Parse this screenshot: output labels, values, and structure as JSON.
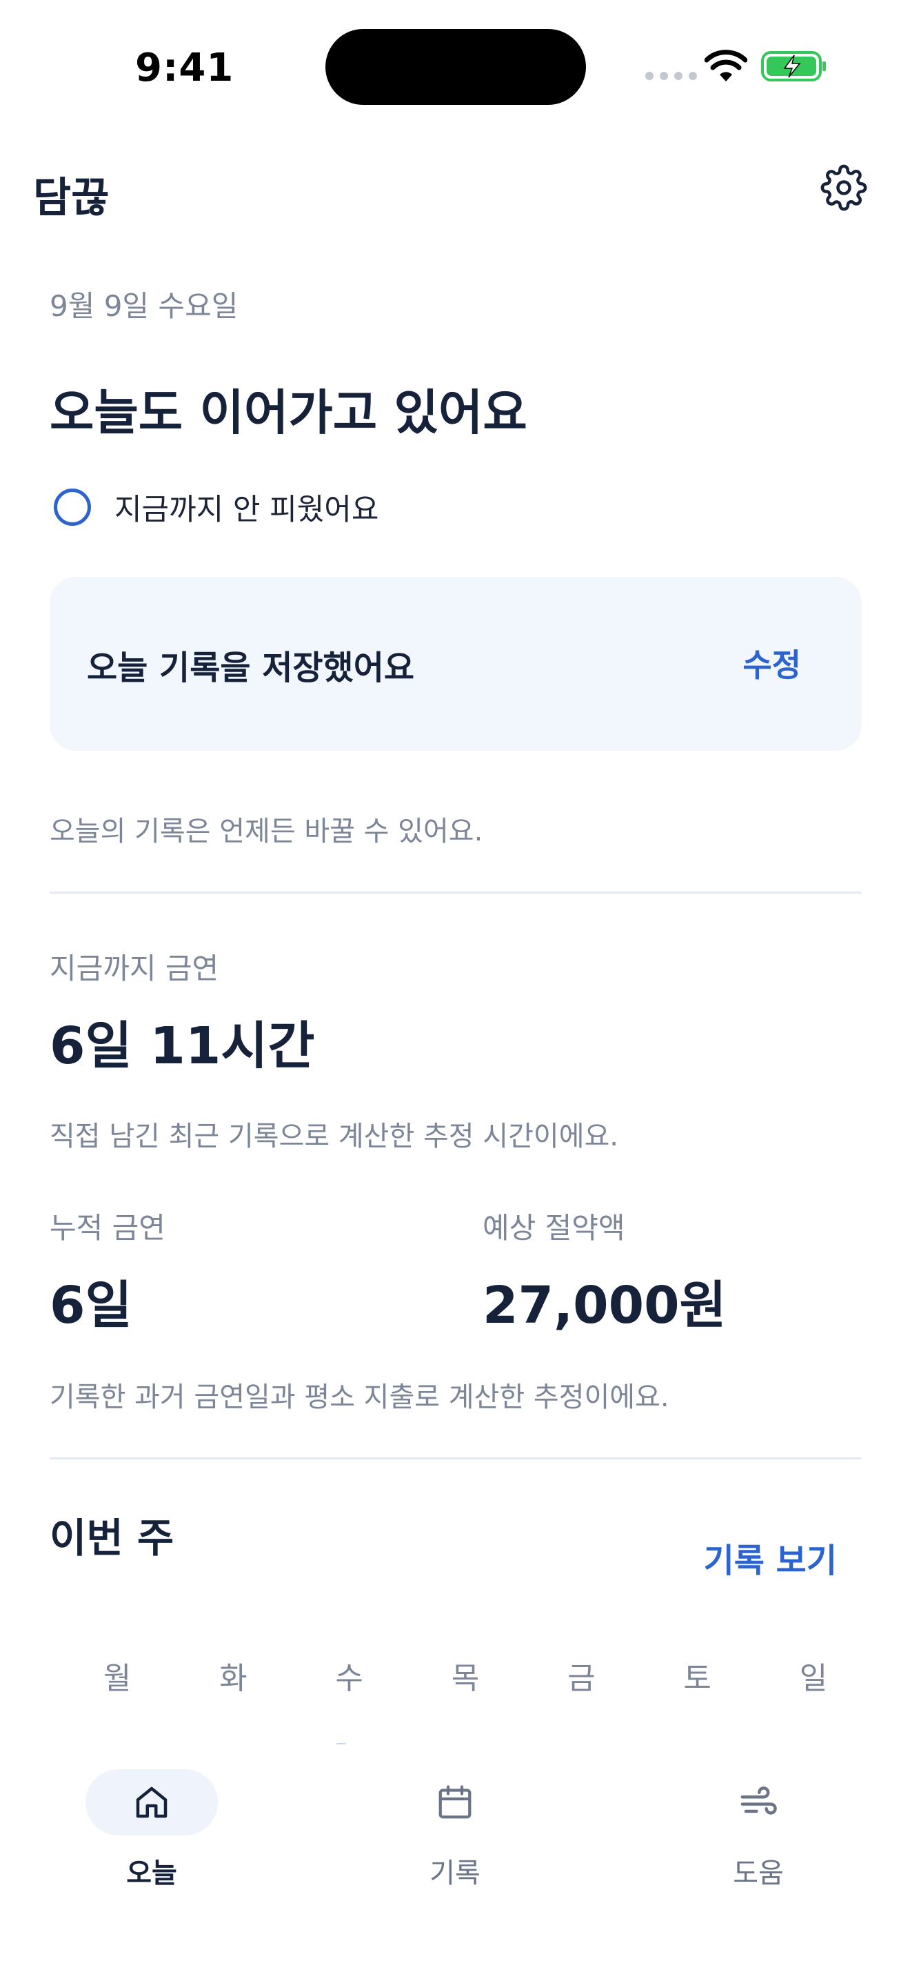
{
  "status_bar": {
    "time": "9:41"
  },
  "header": {
    "app_title": "담끊"
  },
  "today": {
    "date": "9월 9일 수요일",
    "headline": "오늘도 이어가고 있어요",
    "check_label": "지금까지 안 피웠어요",
    "saved_text": "오늘 기록을 저장했어요",
    "edit_label": "수정",
    "note": "오늘의 기록은 언제든 바꿀 수 있어요."
  },
  "streak": {
    "label": "지금까지 금연",
    "value": "6일 11시간",
    "note": "직접 남긴 최근 기록으로 계산한 추정 시간이에요."
  },
  "stats": {
    "cumulative_label": "누적 금연",
    "cumulative_value": "6일",
    "savings_label": "예상 절약액",
    "savings_value": "27,000원",
    "note": "기록한 과거 금연일과 평소 지출로 계산한 추정이에요."
  },
  "week": {
    "title": "이번 주",
    "records_link": "기록 보기",
    "days": [
      "월",
      "화",
      "수",
      "목",
      "금",
      "토",
      "일"
    ]
  },
  "nav": {
    "items": [
      {
        "label": "오늘",
        "icon": "home-icon",
        "active": true
      },
      {
        "label": "기록",
        "icon": "calendar-icon",
        "active": false
      },
      {
        "label": "도움",
        "icon": "wind-icon",
        "active": false
      }
    ]
  },
  "colors": {
    "accent": "#2d63cf",
    "text_primary": "#16213a",
    "text_secondary": "#7c8698",
    "card_bg": "#f2f6fd",
    "battery_green": "#34c759"
  }
}
